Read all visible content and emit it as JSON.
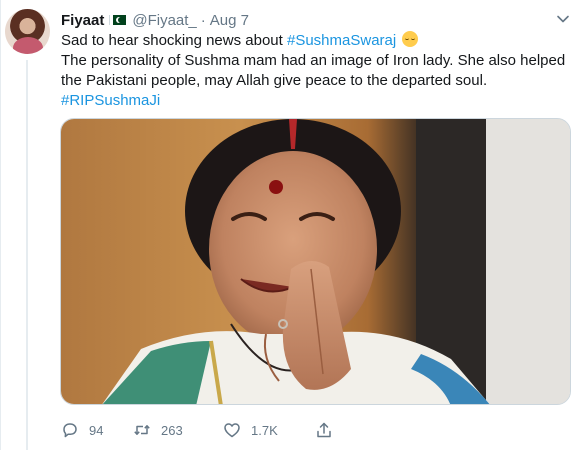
{
  "author": {
    "name": "Fiyaat",
    "handle": "@Fiyaat_",
    "separator": "·",
    "date": "Aug 7",
    "flag_icon": "pakistan-flag-icon"
  },
  "tweet": {
    "line1_text": "Sad to hear shocking news about ",
    "line1_hashtag": "#SushmaSwaraj",
    "line1_emoji": "relieved-face-emoji",
    "line2": "The personality of Sushma mam had an image of Iron lady. She also helped",
    "line3": "the Pakistani people, may Allah give peace to the departed soul.",
    "line4_hashtag": "#RIPSushmaJi"
  },
  "media": {
    "description_icon": "photo-woman-namaste"
  },
  "actions": {
    "reply_count": "94",
    "retweet_count": "263",
    "like_count": "1.7K",
    "reply_icon": "reply-icon",
    "retweet_icon": "retweet-icon",
    "like_icon": "heart-icon",
    "share_icon": "share-icon"
  },
  "colors": {
    "link": "#1b95e0",
    "muted": "#657786",
    "text": "#14171a",
    "border": "#e6ecf0"
  }
}
